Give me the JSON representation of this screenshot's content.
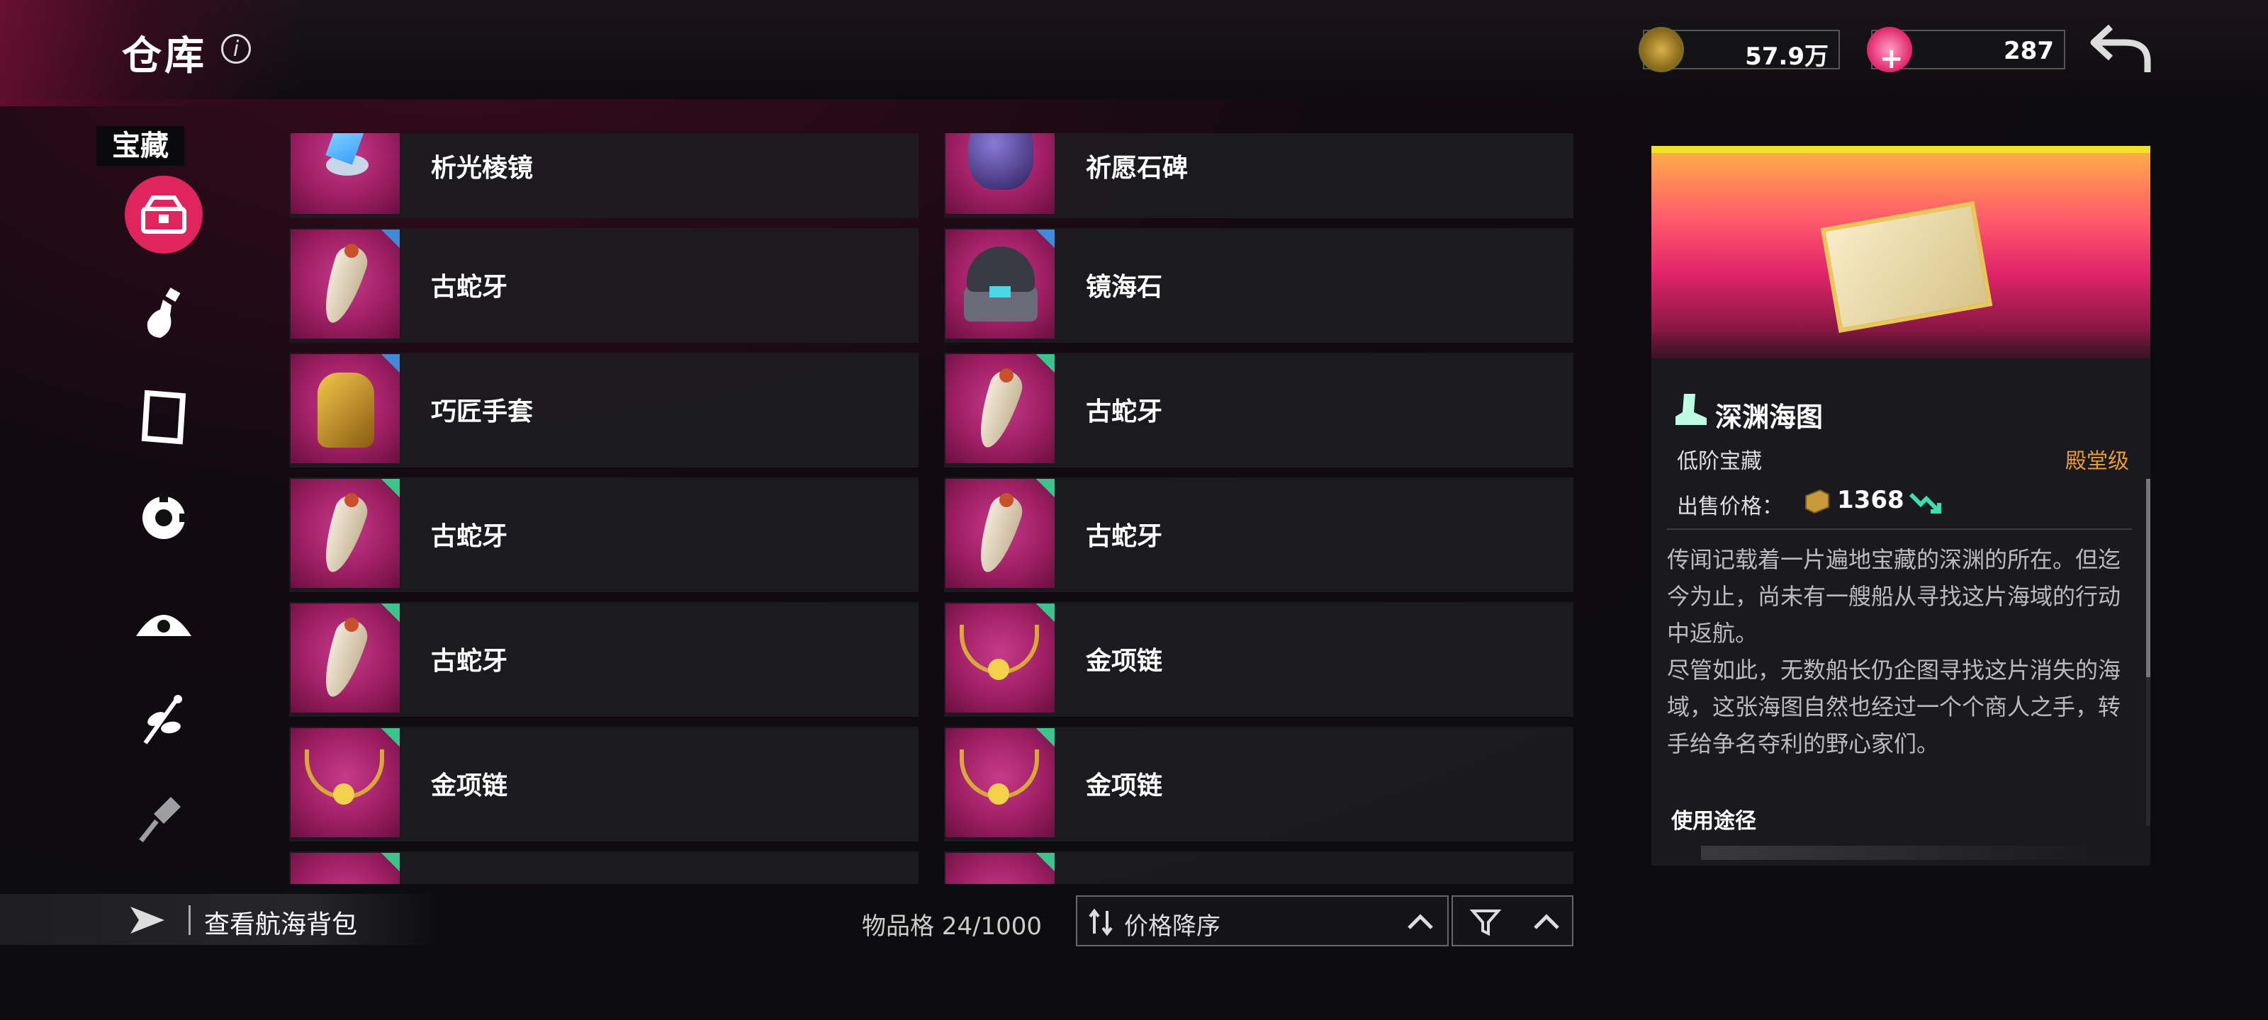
{
  "header": {
    "title": "仓库",
    "info_icon": "info-icon"
  },
  "currency": [
    {
      "icon": "coin-relic-icon",
      "value": "57.9万"
    },
    {
      "icon": "pink-gem-icon",
      "value": "287"
    }
  ],
  "sidebar": {
    "category_title": "宝藏",
    "items": [
      {
        "icon": "treasure-chest-icon",
        "active": true
      },
      {
        "icon": "potion-bottle-icon",
        "active": false
      },
      {
        "icon": "scroll-frame-icon",
        "active": false
      },
      {
        "icon": "gear-part-icon",
        "active": false
      },
      {
        "icon": "ship-wheel-icon",
        "active": false
      },
      {
        "icon": "herb-branch-icon",
        "active": false
      },
      {
        "icon": "shovel-icon",
        "active": false
      }
    ]
  },
  "items": [
    {
      "name": "析光棱镜",
      "icon": "prism-icon"
    },
    {
      "name": "祈愿石碑",
      "icon": "wish-stone-icon"
    },
    {
      "name": "古蛇牙",
      "icon": "serpent-fang-icon",
      "rarity": "blue"
    },
    {
      "name": "镜海石",
      "icon": "jewel-box-icon",
      "rarity": "blue"
    },
    {
      "name": "巧匠手套",
      "icon": "gauntlet-icon",
      "rarity": "blue"
    },
    {
      "name": "古蛇牙",
      "icon": "serpent-fang-icon",
      "rarity": "green"
    },
    {
      "name": "古蛇牙",
      "icon": "serpent-fang-icon",
      "rarity": "green"
    },
    {
      "name": "古蛇牙",
      "icon": "serpent-fang-icon",
      "rarity": "green"
    },
    {
      "name": "古蛇牙",
      "icon": "serpent-fang-icon",
      "rarity": "green"
    },
    {
      "name": "金项链",
      "icon": "gold-necklace-icon",
      "rarity": "green"
    },
    {
      "name": "金项链",
      "icon": "gold-necklace-icon",
      "rarity": "green"
    },
    {
      "name": "金项链",
      "icon": "gold-necklace-icon",
      "rarity": "green"
    },
    {
      "name": "",
      "icon": "prism-icon",
      "rarity": "green"
    },
    {
      "name": "",
      "icon": "wish-stone-icon",
      "rarity": "green"
    }
  ],
  "footer": {
    "backpack_label": "查看航海背包",
    "slots_text": "物品格 24/1000",
    "sort_label": "价格降序"
  },
  "detail": {
    "name": "深渊海图",
    "tier": "低阶宝藏",
    "grade": "殿堂级",
    "price_label": "出售价格：",
    "price_value": "1368",
    "description_1": "传闻记载着一片遍地宝藏的深渊的所在。但迄今为止，尚未有一艘船从寻找这片海域的行动中返航。",
    "description_2": "尽管如此，无数船长仍企图寻找这片消失的海域，这张海图自然也经过一个个商人之手，转手给争名夺利的野心家们。",
    "use_label": "使用途径"
  },
  "colors": {
    "accent_pink": "#e0245e",
    "grade_orange": "#e89a3c",
    "rarity_blue": "#3d8bd9",
    "rarity_green": "#3cc58a",
    "detail_top_line": "#f2e02c"
  }
}
